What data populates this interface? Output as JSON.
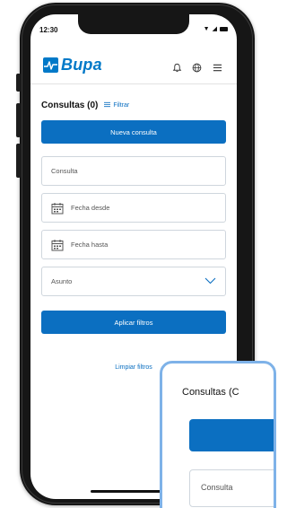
{
  "status_bar": {
    "time": "12:30"
  },
  "header": {
    "brand": "Bupa",
    "icons": [
      "bell-icon",
      "globe-icon",
      "menu-icon"
    ]
  },
  "toolbar": {
    "title": "Consultas (0)",
    "filter_label": "Filtrar"
  },
  "buttons": {
    "new_consult": "Nueva consulta",
    "apply_filters": "Aplicar filtros",
    "clear_filters": "Limpiar filtros"
  },
  "form": {
    "consulta_placeholder": "Consulta",
    "date_from": "Fecha desde",
    "date_to": "Fecha hasta",
    "subject": "Asunto"
  },
  "zoom": {
    "title": "Consultas (C",
    "field_placeholder": "Consulta"
  },
  "colors": {
    "brand": "#0079c8",
    "primary": "#0b6fc1",
    "zoom_border": "#7eb2e8"
  }
}
